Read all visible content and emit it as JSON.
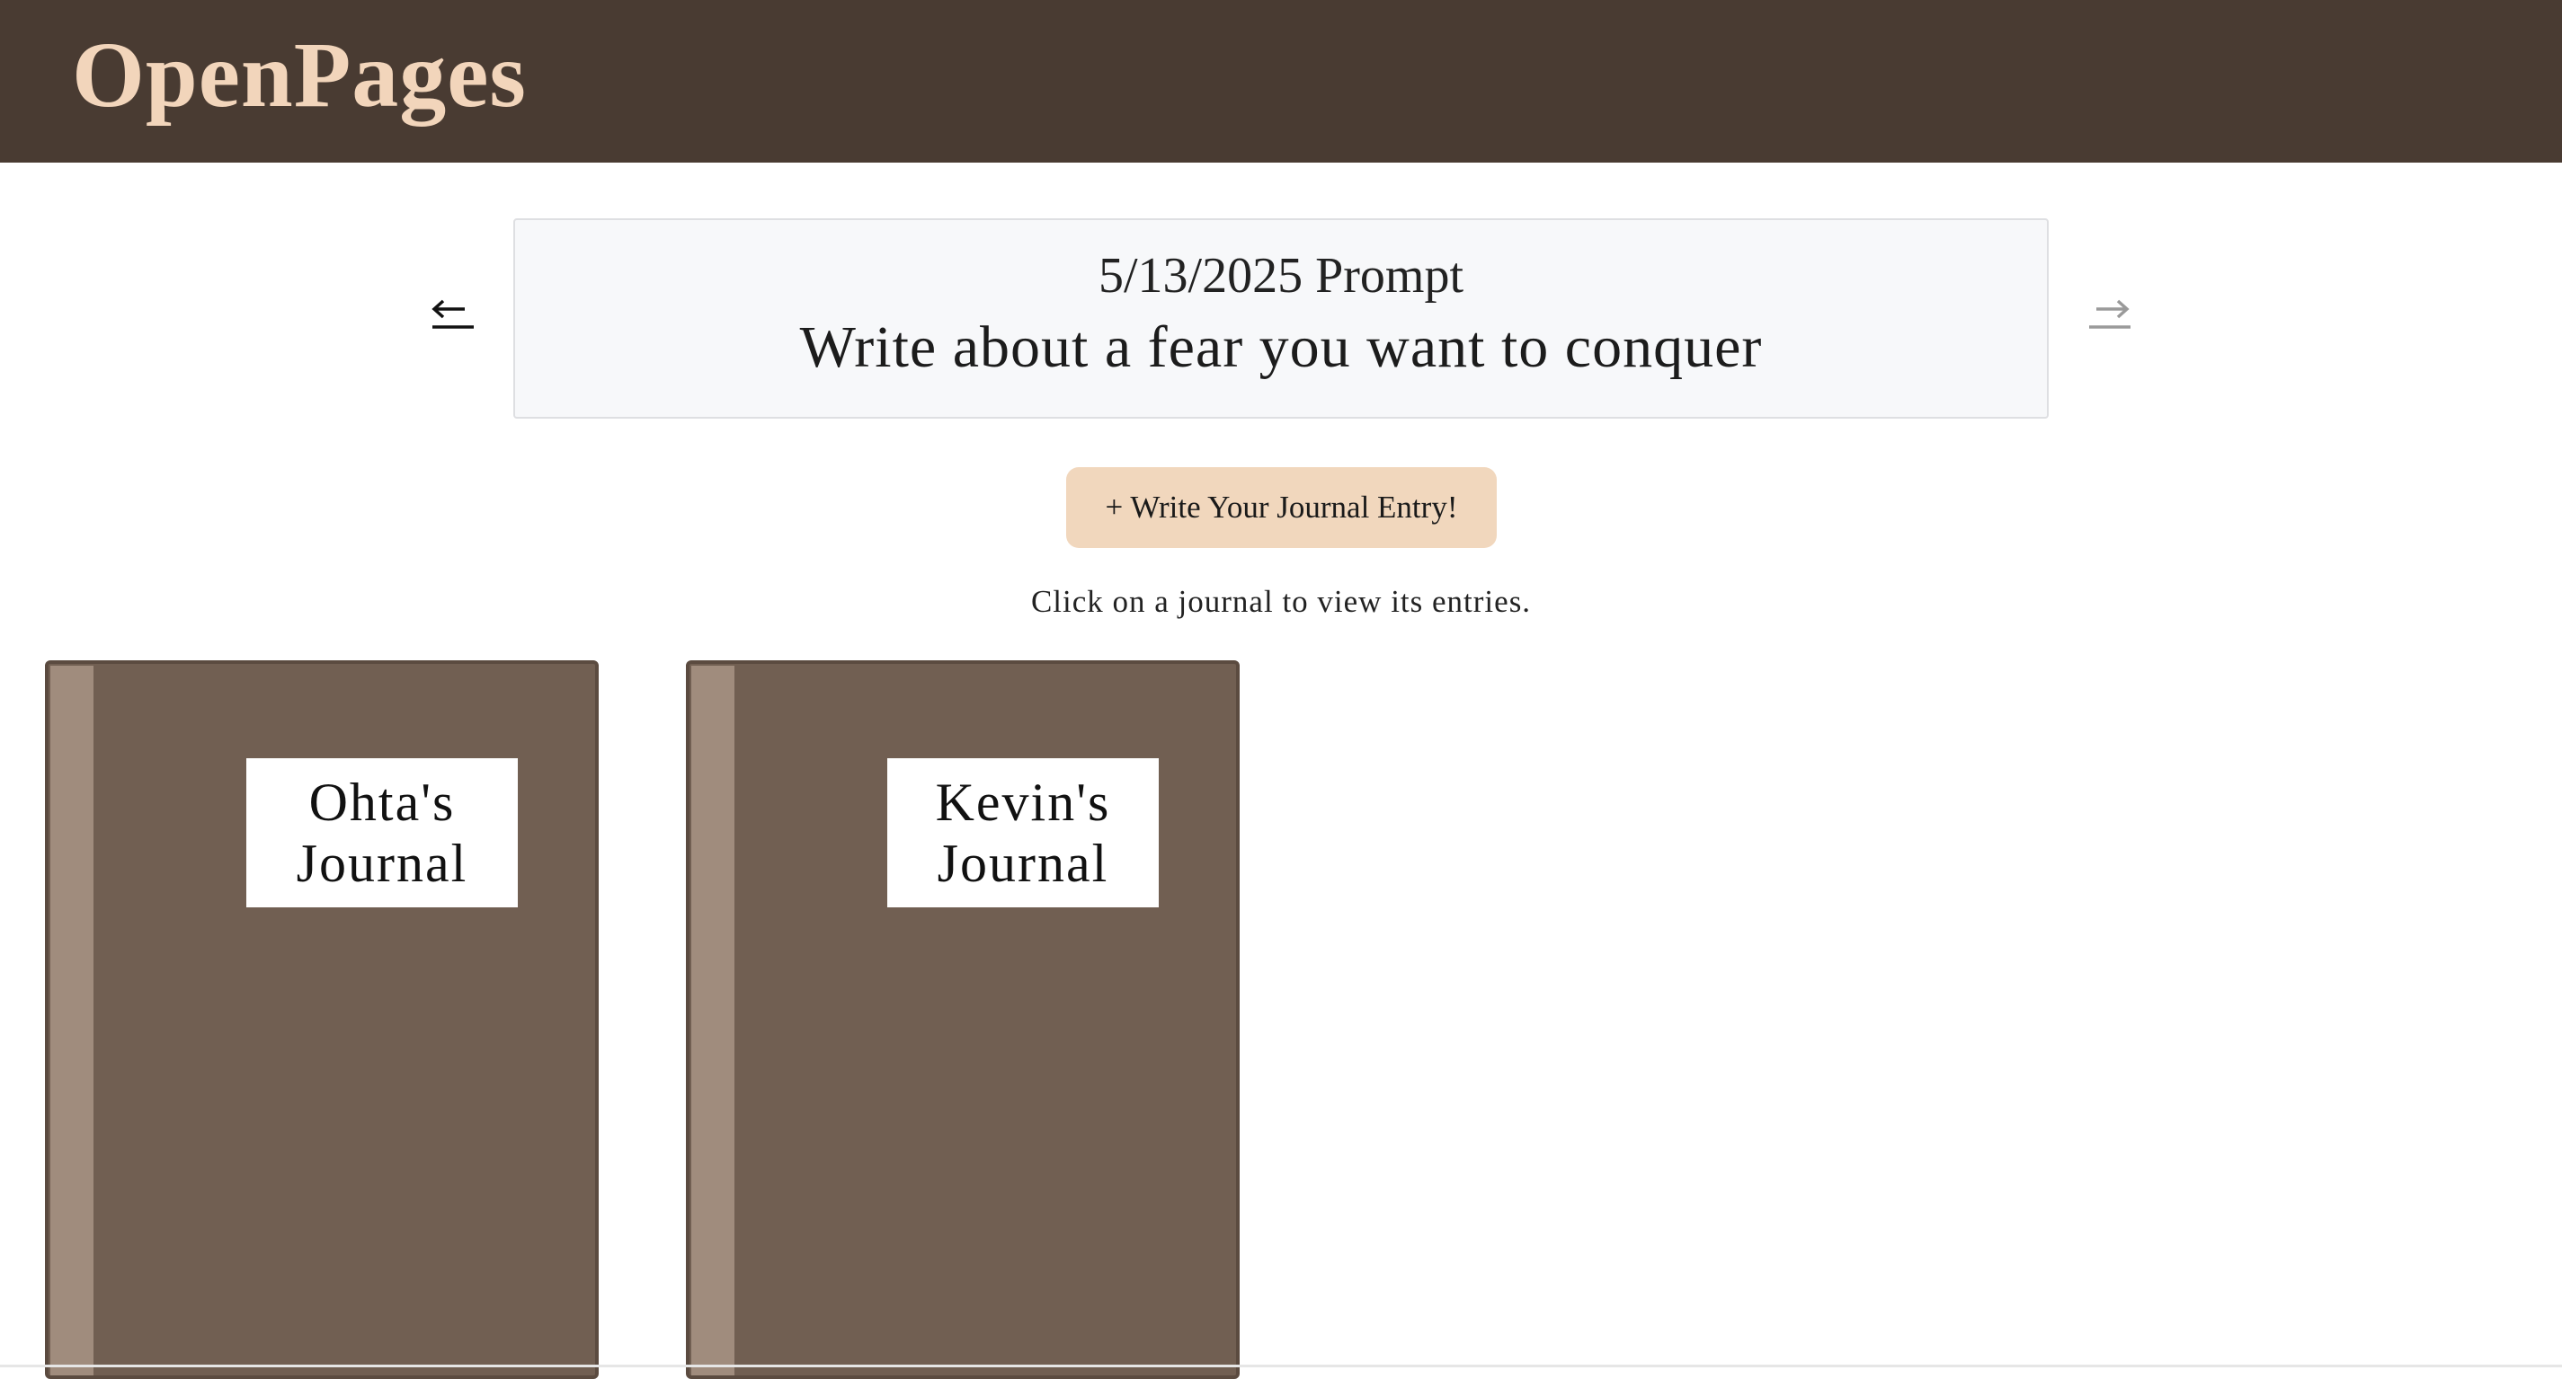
{
  "header": {
    "logo": "OpenPages"
  },
  "prompt": {
    "date_label": "5/13/2025 Prompt",
    "text": "Write about a fear you want to conquer",
    "prev_icon": "arrow-left-icon",
    "next_icon": "arrow-right-icon"
  },
  "actions": {
    "write_entry_label": "+ Write Your Journal Entry!"
  },
  "hint": "Click on a journal to view its entries.",
  "journals": [
    {
      "title": "Ohta's Journal"
    },
    {
      "title": "Kevin's Journal"
    }
  ],
  "colors": {
    "header_bg": "#493b32",
    "logo": "#f2d5bb",
    "button_bg": "#f1d7bd",
    "journal_cover": "#715f52",
    "journal_spine": "#a08c7d",
    "prompt_box_bg": "#f7f8fa"
  }
}
